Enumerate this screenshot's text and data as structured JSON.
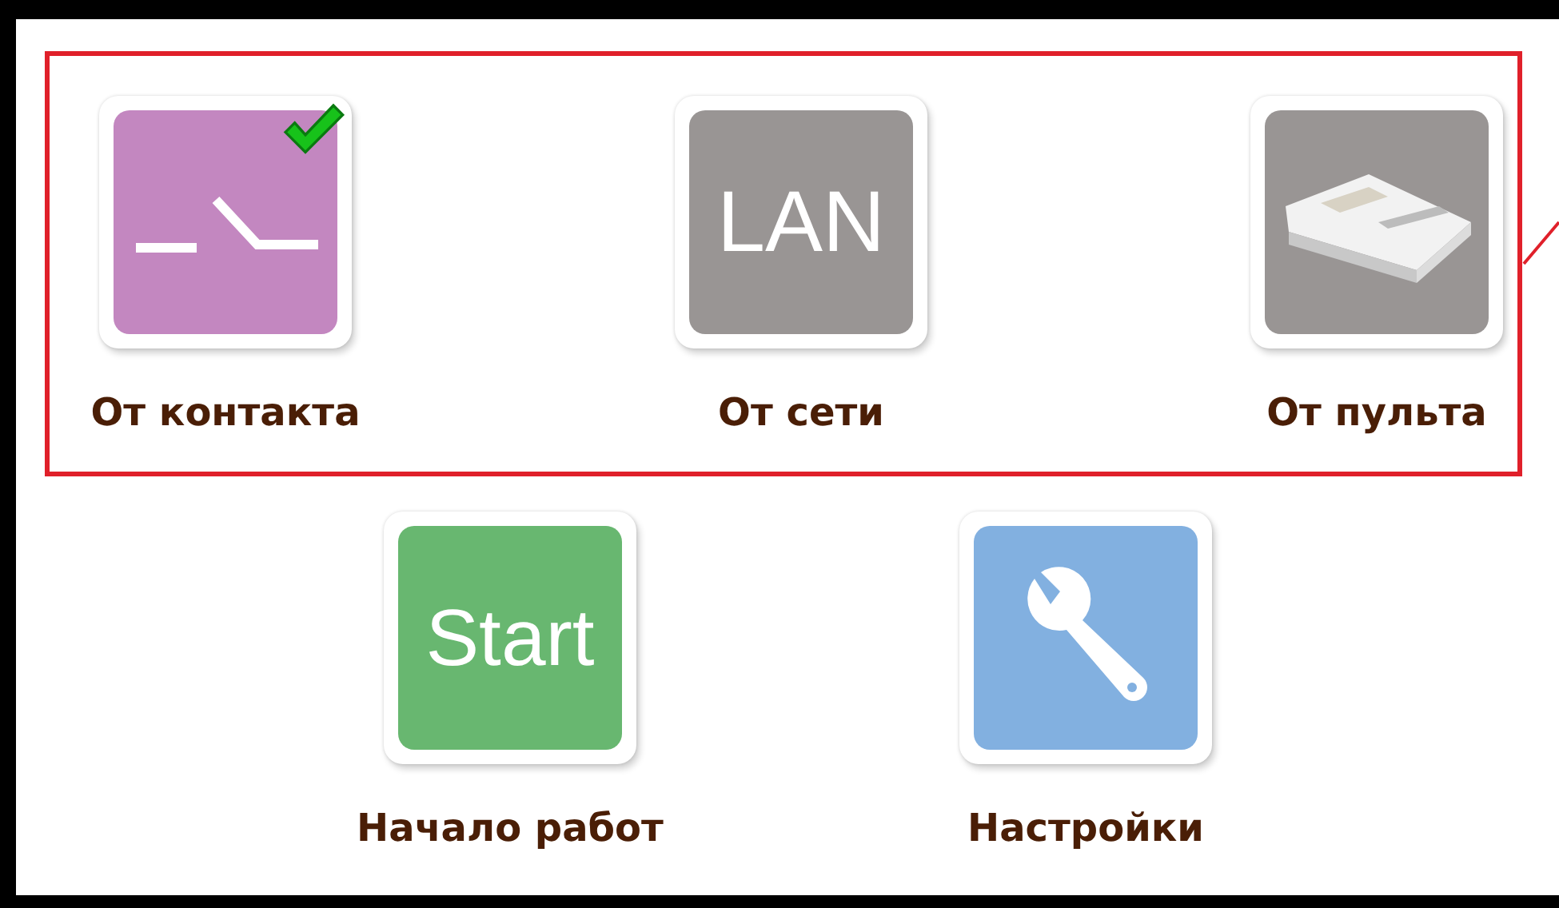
{
  "trigger_sources": [
    {
      "label": "От контакта",
      "kind": "switch",
      "selected": true
    },
    {
      "label": "От сети",
      "kind": "text",
      "text": "LAN",
      "selected": false
    },
    {
      "label": "От пульта",
      "kind": "console",
      "selected": false
    }
  ],
  "actions": [
    {
      "label": "Начало работ",
      "kind": "text",
      "text": "Start",
      "color": "#68b770"
    },
    {
      "label": "Настройки",
      "kind": "wrench",
      "color": "#82b0e0"
    }
  ]
}
